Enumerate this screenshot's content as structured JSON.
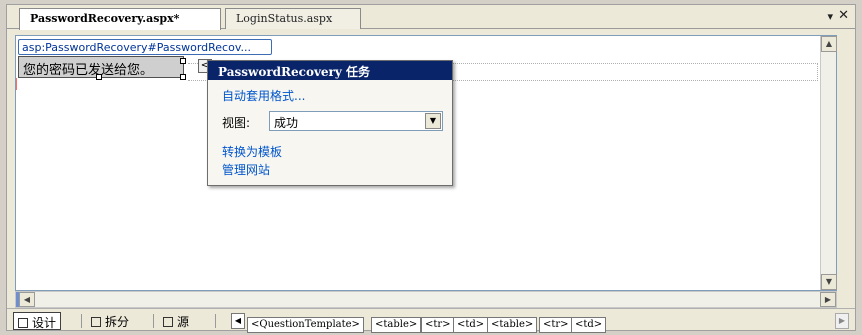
{
  "tabs": [
    {
      "label": "PasswordRecovery.aspx*",
      "active": true
    },
    {
      "label": "LoginStatus.aspx",
      "active": false
    }
  ],
  "tab_controls": {
    "menu_icon": "dropdown-arrow-icon",
    "close_icon": "close-icon",
    "menu_glyph": "▾",
    "close_glyph": "✕"
  },
  "design": {
    "control_tag": "asp:PasswordRecovery#PasswordRecov...",
    "control_text": "您的密码已发送给您。",
    "smart_tag_glyph": "<"
  },
  "smart_panel": {
    "title": "PasswordRecovery 任务",
    "autoformat_link": "自动套用格式...",
    "view_label": "视图:",
    "view_value": "成功",
    "convert_link": "转换为模板",
    "manage_link": "管理网站"
  },
  "bottom": {
    "design_btn": "设计",
    "split_btn": "拆分",
    "source_btn": "源",
    "breadcrumbs": [
      "<QuestionTemplate>",
      "<table>",
      "<tr>",
      "<td>",
      "<table>",
      "<tr>",
      "<td>"
    ]
  },
  "colors": {
    "panel_title_bg": "#0a246a",
    "link": "#0055cc",
    "tag_border": "#3c6cb4"
  }
}
